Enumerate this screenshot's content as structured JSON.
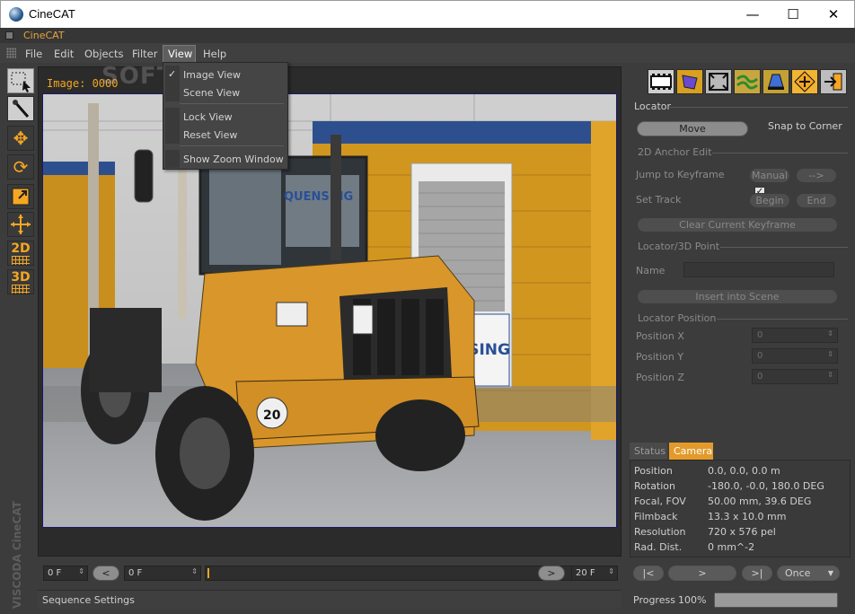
{
  "window": {
    "title": "CineCAT",
    "controls": {
      "minimize": "—",
      "maximize": "☐",
      "close": "✕"
    }
  },
  "app_bar": {
    "label": "CineCAT"
  },
  "menubar": {
    "items": [
      "File",
      "Edit",
      "Objects",
      "Filter",
      "View",
      "Help"
    ],
    "open_menu": "View"
  },
  "view_menu": {
    "items": [
      {
        "label": "Image View",
        "checked": true
      },
      {
        "label": "Scene View",
        "checked": false
      },
      {
        "label": "Lock View",
        "checked": false
      },
      {
        "label": "Reset View",
        "checked": false
      },
      {
        "label": "Show Zoom Window",
        "checked": false
      }
    ]
  },
  "left_tools": {
    "items": [
      "select-icon",
      "magic-wand-icon",
      "move-icon",
      "rotate-icon",
      "scale-icon",
      "axis-icon",
      "2D",
      "3D"
    ]
  },
  "viewport": {
    "frame_label": "Image: 0000",
    "watermark": "SOFTPEDIA",
    "brand_vertical": "VISCODA CineCAT",
    "scene_sign_1": "QUENSING",
    "scene_sign_2": "NSING",
    "scene_plate": "20"
  },
  "timeline": {
    "start_value": "0 F",
    "prev_label": "<",
    "current_value": "0 F",
    "next_label": ">",
    "end_value": "20 F"
  },
  "status_left": {
    "text": "Sequence Settings"
  },
  "right_toolbar": {
    "icons": [
      "film-strip-icon",
      "object-icon",
      "frame-icon",
      "track-icon",
      "lamp-icon",
      "locator-icon",
      "export-icon"
    ]
  },
  "locator": {
    "section_title": "Locator",
    "move_label": "Move",
    "snap_label": "Snap to Corner",
    "snap_checked": true,
    "anchor_section": "2D Anchor Edit",
    "jump_label": "Jump to Keyframe",
    "manual_label": "Manual",
    "arrow_label": "-->",
    "set_track_label": "Set Track",
    "begin_label": "Begin",
    "end_label": "End",
    "clear_label": "Clear Current Keyframe",
    "point_section": "Locator/3D Point",
    "name_label": "Name",
    "name_value": "",
    "insert_label": "Insert into Scene",
    "position_section": "Locator Position",
    "pos_x_label": "Position X",
    "pos_x_value": "0",
    "pos_y_label": "Position Y",
    "pos_y_value": "0",
    "pos_z_label": "Position Z",
    "pos_z_value": "0"
  },
  "tabs": {
    "status": "Status",
    "camera": "Camera",
    "active": "Camera"
  },
  "camera_info": {
    "rows": [
      {
        "key": "Position",
        "value": "0.0, 0.0, 0.0 m"
      },
      {
        "key": "Rotation",
        "value": "-180.0, -0.0, 180.0 DEG"
      },
      {
        "key": "Focal, FOV",
        "value": "50.00 mm, 39.6 DEG"
      },
      {
        "key": "Filmback",
        "value": "13.3 x 10.0 mm"
      },
      {
        "key": "Resolution",
        "value": "720 x 576 pel"
      },
      {
        "key": "Rad. Dist.",
        "value": "0 mm^-2"
      }
    ]
  },
  "playback": {
    "first_label": "|<",
    "play_label": ">",
    "last_label": ">|",
    "mode_value": "Once"
  },
  "progress": {
    "label": "Progress",
    "percent_text": "100%",
    "value": 1.0
  },
  "colors": {
    "accent": "#f5a623",
    "panel": "#3c3c3c",
    "highlight_border": "#1a1a6e"
  }
}
